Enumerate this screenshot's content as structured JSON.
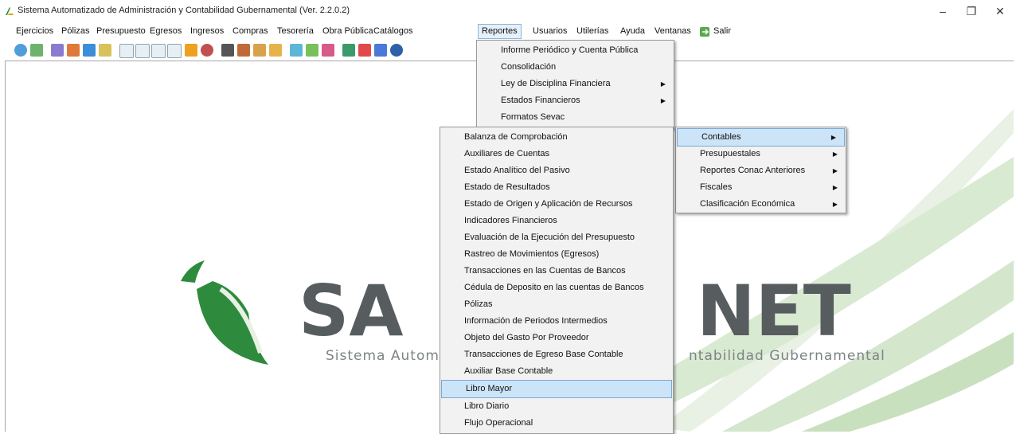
{
  "window": {
    "title": "Sistema Automatizado de Administración y Contabilidad Gubernamental (Ver. 2.2.0.2)",
    "minimize": "–",
    "maximize": "❐",
    "close": "✕"
  },
  "menubar": {
    "items": [
      "Ejercicios",
      "Pólizas",
      "Presupuesto",
      "Egresos",
      "Ingresos",
      "Compras",
      "Tesorería",
      "Obra Pública",
      "Catálogos",
      "Reportes",
      "Usuarios",
      "Utilerías",
      "Ayuda",
      "Ventanas",
      "Salir"
    ]
  },
  "reportes_menu": {
    "items": [
      {
        "label": "Informe Periódico y Cuenta Pública",
        "submenu": false
      },
      {
        "label": "Consolidación",
        "submenu": false
      },
      {
        "label": "Ley de Disciplina Financiera",
        "submenu": true
      },
      {
        "label": "Estados Financieros",
        "submenu": true
      },
      {
        "label": "Formatos Sevac",
        "submenu": false
      }
    ]
  },
  "estados_submenu": {
    "items": [
      {
        "label": "Contables",
        "submenu": true,
        "highlighted": true
      },
      {
        "label": "Presupuestales",
        "submenu": true
      },
      {
        "label": "Reportes Conac Anteriores",
        "submenu": true
      },
      {
        "label": "Fiscales",
        "submenu": true
      },
      {
        "label": "Clasificación Económica",
        "submenu": true
      }
    ]
  },
  "contables_submenu": {
    "items": [
      {
        "label": "Balanza de Comprobación"
      },
      {
        "label": "Auxiliares de Cuentas"
      },
      {
        "label": "Estado Analítico del Pasivo"
      },
      {
        "label": "Estado de Resultados"
      },
      {
        "label": "Estado de Origen y Aplicación de Recursos"
      },
      {
        "label": "Indicadores Financieros"
      },
      {
        "label": "Evaluación de la Ejecución del Presupuesto"
      },
      {
        "label": "Rastreo de  Movimientos (Egresos)"
      },
      {
        "label": "Transacciones en las Cuentas de Bancos"
      },
      {
        "label": "Cédula de Deposito en las cuentas de Bancos"
      },
      {
        "label": "Pólizas"
      },
      {
        "label": "Información de Periodos Intermedios"
      },
      {
        "label": "Objeto del Gasto Por Proveedor"
      },
      {
        "label": "Transacciones de Egreso Base Contable"
      },
      {
        "label": "Auxiliar Base Contable"
      },
      {
        "label": "Libro Mayor",
        "highlighted": true
      },
      {
        "label": "Libro Diario"
      },
      {
        "label": "Flujo Operacional"
      }
    ]
  },
  "logo": {
    "left": "SA",
    "right": "NET",
    "tagline_left": "Sistema Automa",
    "tagline_right": "ntabilidad Gubernamental",
    "green": "#2e8b3e",
    "gray": "#575d5e"
  },
  "toolbar_icons": [
    "refresh-icon",
    "new-doc-icon",
    "users-icon",
    "import-icon",
    "export-icon",
    "table-icon",
    "c-icon",
    "d-icon",
    "e-icon",
    "f-icon",
    "p-icon",
    "tools-icon",
    "trash-icon",
    "edit-icon",
    "folder-icon",
    "package-icon",
    "notes-icon",
    "chart-icon",
    "tree-icon",
    "shield-icon",
    "report-icon",
    "help-icon"
  ]
}
